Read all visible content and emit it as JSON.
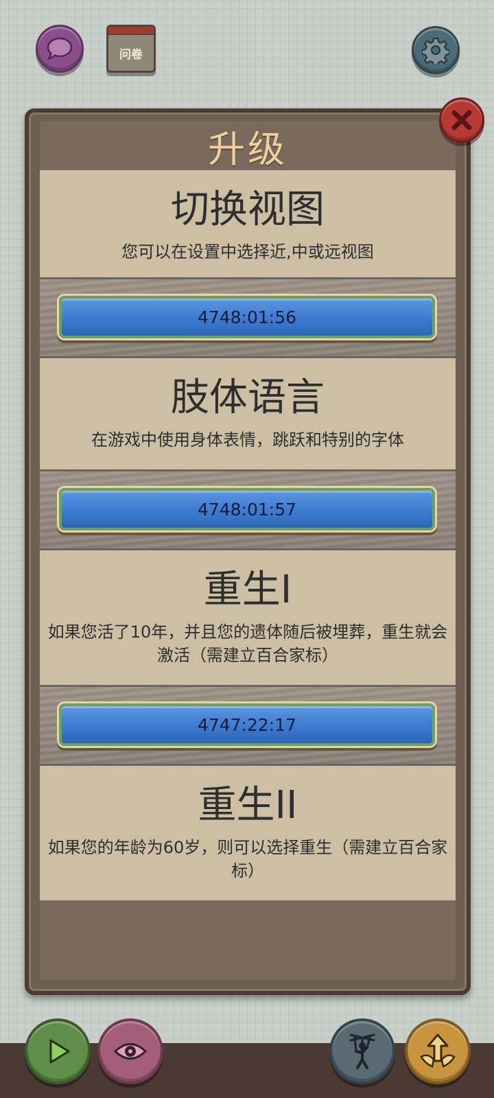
{
  "top_bar": {
    "survey_label": "问卷"
  },
  "panel": {
    "title": "升级",
    "upgrades": [
      {
        "title": "切换视图",
        "description": "您可以在设置中选择近,中或远视图",
        "timer": "4748:01:56"
      },
      {
        "title": "肢体语言",
        "description": "在游戏中使用身体表情，跳跃和特别的字体",
        "timer": "4748:01:57"
      },
      {
        "title": "重生I",
        "description": "如果您活了10年，并且您的遗体随后被埋葬，重生就会激活（需建立百合家标）",
        "timer": "4747:22:17"
      },
      {
        "title": "重生II",
        "description": "如果您的年龄为60岁，则可以选择重生（需建立百合家标）"
      }
    ]
  },
  "colors": {
    "timer_button": "#3d7bd0",
    "panel_title": "#efd09a",
    "card_bg": "#cdbfa3",
    "close_button": "#b53a34"
  },
  "icons": [
    "chat-icon",
    "survey-icon",
    "gear-icon",
    "close-icon",
    "play-icon",
    "eye-icon",
    "puppet-icon",
    "upgrade-arrow-icon"
  ]
}
